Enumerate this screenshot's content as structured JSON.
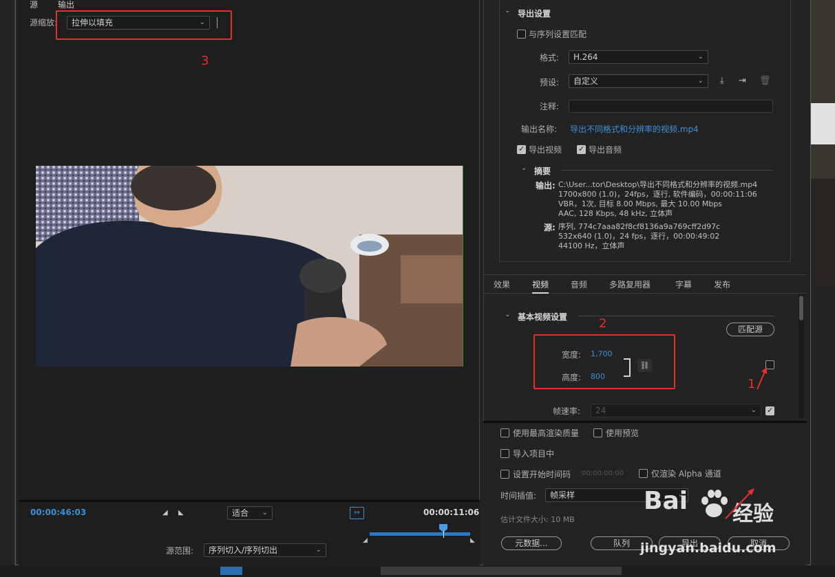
{
  "left": {
    "tab_source": "源",
    "tab_output": "输出",
    "scale_label": "源缩放:",
    "scale_value": "拉伸以填充",
    "annot_3": "3",
    "timecode_current": "00:00:46:03",
    "fit_value": "适合",
    "timecode_duration": "00:00:11:06",
    "range_label": "源范围:",
    "range_value": "序列切入/序列切出"
  },
  "export": {
    "header": "导出设置",
    "match_sequence": "与序列设置匹配",
    "format_label": "格式:",
    "format_value": "H.264",
    "preset_label": "预设:",
    "preset_value": "自定义",
    "comment_label": "注释:",
    "output_name_label": "输出名称:",
    "output_name_value": "导出不同格式和分辨率的视频.mp4",
    "export_video": "导出视频",
    "export_audio": "导出音频",
    "summary_header": "摘要",
    "summary_output_label": "输出:",
    "summary_output_lines": [
      "C:\\User...tor\\Desktop\\导出不同格式和分辨率的视频.mp4",
      "1700x800 (1.0)，24fps，逐行, 软件编码，00:00:11:06",
      "VBR，1次, 目标 8.00 Mbps, 最大 10.00 Mbps",
      "AAC, 128 Kbps, 48 kHz, 立体声"
    ],
    "summary_source_label": "源:",
    "summary_source_lines": [
      "序列, 774c7aaa82f8cf8136a9a769cff2d97c",
      "532x640 (1.0)，24 fps，逐行，00:00:49:02",
      "44100 Hz，立体声"
    ]
  },
  "tabs": [
    "效果",
    "视频",
    "音频",
    "多路复用器",
    "字幕",
    "发布"
  ],
  "active_tab": "视频",
  "video": {
    "header": "基本视频设置",
    "match_source": "匹配源",
    "width_label": "宽度:",
    "width_value": "1,700",
    "height_label": "高度:",
    "height_value": "800",
    "framerate_label": "帧速率:",
    "framerate_value": "24",
    "annot_2": "2",
    "annot_1": "1"
  },
  "bottom": {
    "max_render": "使用最高渲染质量",
    "use_preview": "使用预览",
    "import_project": "导入项目中",
    "set_start_tc": "设置开始时间码",
    "start_tc_value": "00:00:00:00",
    "alpha_only": "仅渲染 Alpha 通道",
    "time_interp_label": "时间插值:",
    "time_interp_value": "帧采样",
    "est_size": "估计文件大小: 10 MB",
    "metadata": "元数据...",
    "queue": "队列",
    "export": "导出",
    "cancel": "取消"
  },
  "watermark": {
    "brand": "Bai",
    "brand2": "经验",
    "url": "jingyan.baidu.com"
  },
  "colors": {
    "accent_blue": "#3a8fd8",
    "annotation_red": "#e8302a",
    "panel_bg": "#232323"
  }
}
